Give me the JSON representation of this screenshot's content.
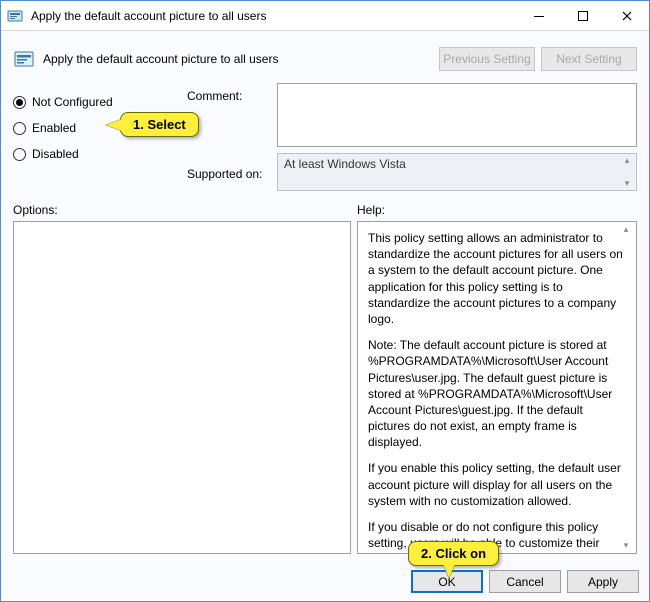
{
  "titlebar": {
    "title": "Apply the default account picture to all users"
  },
  "header": {
    "policy_title": "Apply the default account picture to all users",
    "prev_btn": "Previous Setting",
    "next_btn": "Next Setting"
  },
  "state": {
    "radios": {
      "not_configured": "Not Configured",
      "enabled": "Enabled",
      "disabled": "Disabled",
      "selected": "not_configured"
    },
    "comment_label": "Comment:",
    "comment_value": "",
    "supported_label": "Supported on:",
    "supported_value": "At least Windows Vista"
  },
  "panes": {
    "options_label": "Options:",
    "help_label": "Help:",
    "help_p1": "This policy setting allows an administrator to standardize the account pictures for all users on a system to the default account picture. One application for this policy setting is to standardize the account pictures to a company logo.",
    "help_p2": "Note: The default account picture is stored at %PROGRAMDATA%\\Microsoft\\User Account Pictures\\user.jpg. The default guest picture is stored at %PROGRAMDATA%\\Microsoft\\User Account Pictures\\guest.jpg. If the default pictures do not exist, an empty frame is displayed.",
    "help_p3": "If you enable this policy setting, the default user account picture will display for all users on the system with no customization allowed.",
    "help_p4": "If you disable or do not configure this policy setting, users will be able to customize their account pictures."
  },
  "footer": {
    "ok": "OK",
    "cancel": "Cancel",
    "apply": "Apply"
  },
  "callouts": {
    "c1": "1.  Select",
    "c2": "2.  Click on"
  }
}
